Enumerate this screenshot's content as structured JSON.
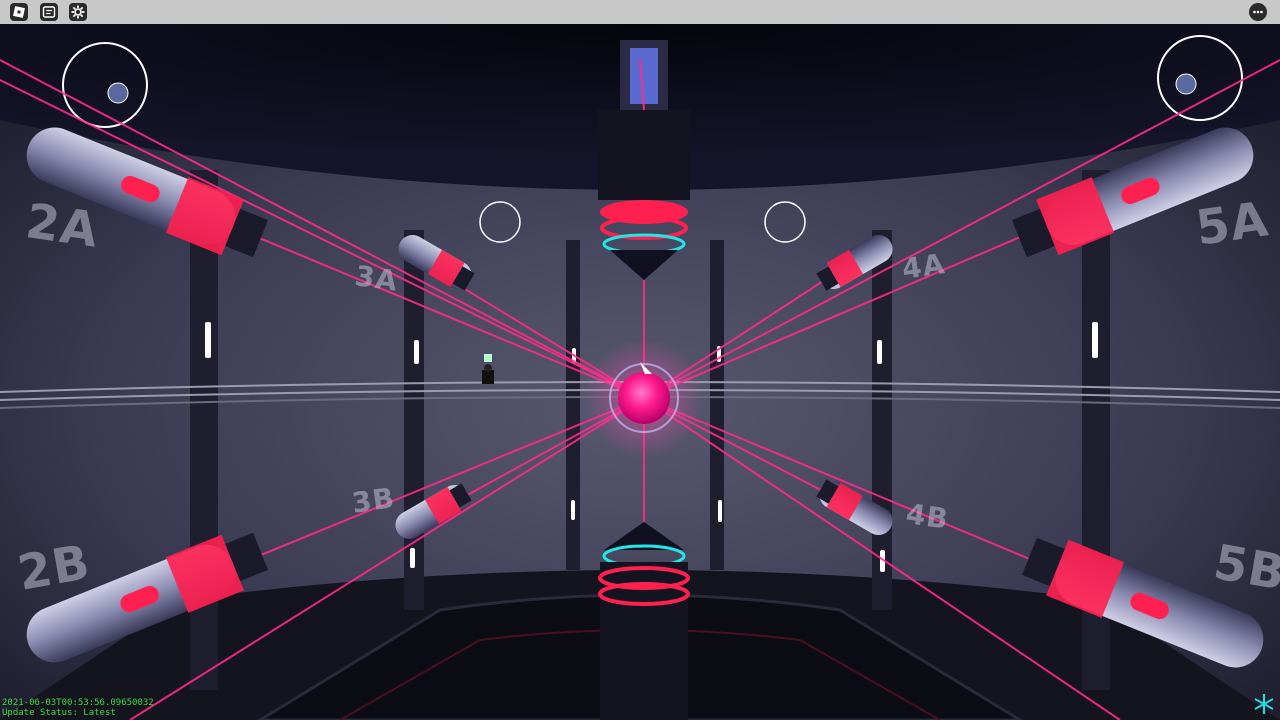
{
  "hud": {
    "menu_icon": "roblox-logo-icon",
    "chat_icon": "chat-icon",
    "settings_icon": "gear-icon",
    "more_icon": "more-options-icon",
    "corner_icon": "snowflake-logo-icon"
  },
  "wall_labels": {
    "l2a": "2A",
    "l2b": "2B",
    "l3a": "3A",
    "l3b": "3B",
    "l4a": "4A",
    "l4b": "4B",
    "l5a": "5A",
    "l5b": "5B"
  },
  "debug": {
    "line1": "2021-06-03T00:53:56.09650032",
    "line2": "Update Status: Latest"
  },
  "colors": {
    "laser": "#ff2a8a",
    "core": "#ff1a8c",
    "accent_cyan": "#20e8e8",
    "emitter_glow": "#ff2050"
  }
}
